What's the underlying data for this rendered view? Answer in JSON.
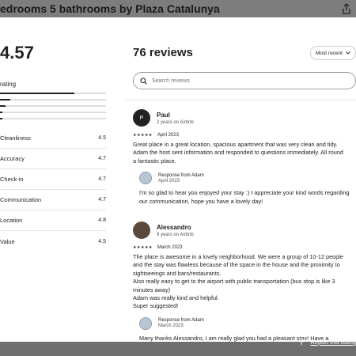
{
  "header": {
    "title": "edrooms 5 bathrooms by Plaza Catalunya"
  },
  "summary": {
    "rating": "4.57",
    "rating_label": "rating",
    "distribution": [
      0.7,
      0.1,
      0.05,
      0.02,
      0.02
    ],
    "categories": [
      {
        "label": "Cleanliness",
        "value": "4.5"
      },
      {
        "label": "Accuracy",
        "value": "4.7"
      },
      {
        "label": "Check-in",
        "value": "4.7"
      },
      {
        "label": "Communication",
        "value": "4.7"
      },
      {
        "label": "Location",
        "value": "4.8"
      },
      {
        "label": "Value",
        "value": "4.5"
      }
    ]
  },
  "reviews_panel": {
    "title": "76 reviews",
    "sort_label": "Most recent",
    "search_placeholder": "Search reviews"
  },
  "reviews": [
    {
      "initial": "P",
      "name": "Paul",
      "meta": "2 years on Airbnb",
      "stars": "★★★★★",
      "date": "April 2023",
      "text": "Great place in a great location, spacious apartment that was very clean and tidy.\nAdam the host sent information and responded to questions immediately. All round\na fantastic place.",
      "response_from": "Response from Adam",
      "response_date": "April 2023",
      "response_text": "I'm so glad to hear you enjoyed your stay :) I appreciate your kind words regarding\nour communication, hope you have a lovely day!"
    },
    {
      "initial": "",
      "name": "Alessandro",
      "meta": "9 years on Airbnb",
      "stars": "★★★★★",
      "date": "March 2023",
      "text": "The place is awesome in a lovely neighborhood. We were a group of 10-12 people\nand the stay was flawless because of the space in the house and the proximity to\nsightseeings and bars/restaurants.\nAlso really easy to get to the airport with public transportation (bus stop is like 3\nminutes away)\nAdam was really kind and helpful.\nSuper suggested!",
      "response_from": "Response from Adam",
      "response_date": "March 2023",
      "response_text": "Many thanks Alessandro, I am really glad you had a pleasant stay! Have a"
    }
  ],
  "footer": {
    "report_label": "Report this listing"
  }
}
